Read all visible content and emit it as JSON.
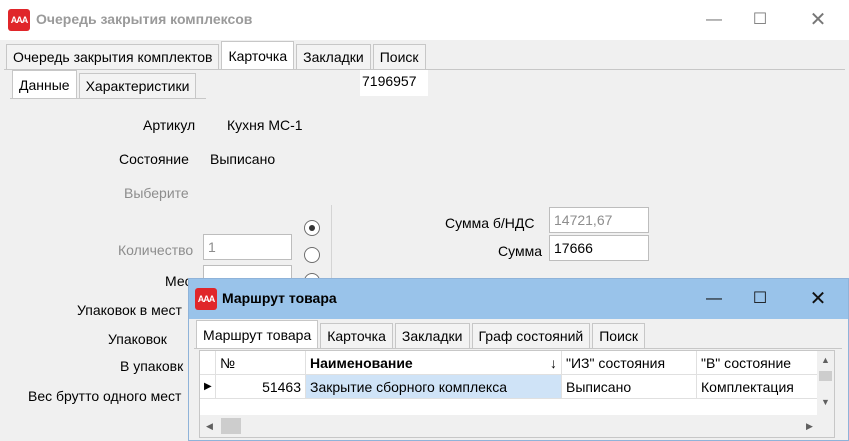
{
  "main_window": {
    "icon_text": "AAA",
    "title": "Очередь закрытия комплексов",
    "tabs": [
      "Очередь закрытия комплектов",
      "Карточка",
      "Закладки",
      "Поиск"
    ],
    "active_tab": "Карточка",
    "subtabs": [
      "Данные",
      "Характеристики"
    ],
    "active_subtab": "Данные",
    "card_number": "7196957",
    "fields": {
      "article_label": "Артикул",
      "article_value": "Кухня МС-1",
      "state_label": "Состояние",
      "state_value": "Выписано",
      "choose_label": "Выберите",
      "quantity_label": "Количество",
      "quantity_value": "1",
      "places_label": "Мес",
      "packs_in_place_label": "Упаковок в мест",
      "packs_label": "Упаковок",
      "in_pack_label": "В упаковк",
      "gross_weight_label": "Вес брутто одного мест",
      "sum_novat_label": "Сумма  б/НДС",
      "sum_novat_value": "14721,67",
      "sum_label": "Сумма",
      "sum_value": "17666"
    }
  },
  "dialog": {
    "icon_text": "AAA",
    "title": "Маршрут товара",
    "tabs": [
      "Маршрут товара",
      "Карточка",
      "Закладки",
      "Граф состояний",
      "Поиск"
    ],
    "active_tab": "Маршрут товара",
    "grid": {
      "columns": [
        "№",
        "Наименование",
        "\"ИЗ\" состояния",
        "\"В\" состояние"
      ],
      "rows": [
        [
          "51463",
          "Закрытие сборного комплекса",
          "Выписано",
          "Комплектация"
        ]
      ]
    }
  }
}
